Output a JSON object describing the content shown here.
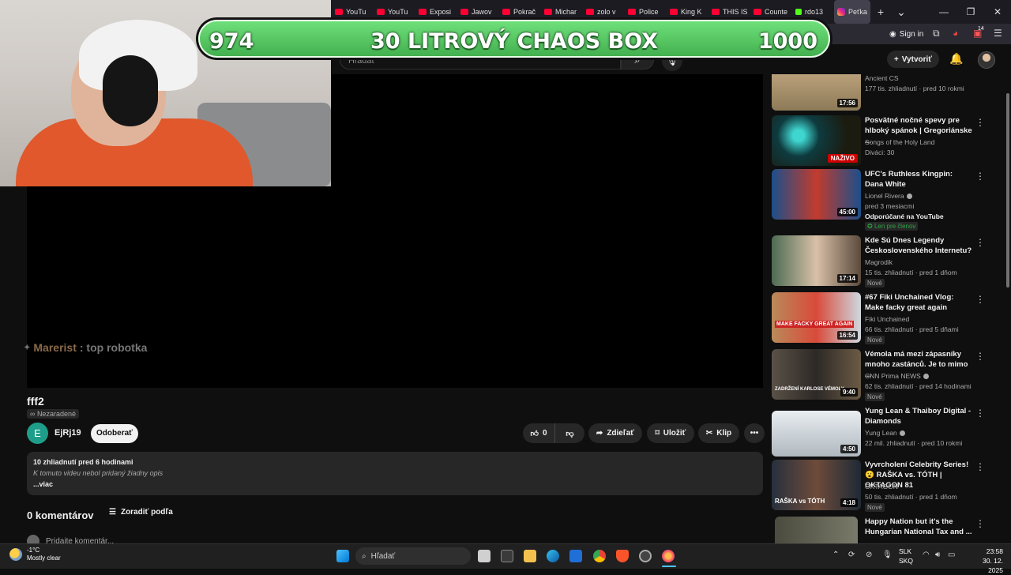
{
  "browser": {
    "tabs": [
      {
        "label": "YouTu",
        "icon": "youtube-icon"
      },
      {
        "label": "YouTu",
        "icon": "youtube-icon"
      },
      {
        "label": "Exposi",
        "icon": "youtube-icon"
      },
      {
        "label": "Jawov",
        "icon": "youtube-icon"
      },
      {
        "label": "Pokrač",
        "icon": "youtube-icon"
      },
      {
        "label": "Michar",
        "icon": "youtube-icon"
      },
      {
        "label": "zolo v",
        "icon": "youtube-icon"
      },
      {
        "label": "Police",
        "icon": "youtube-icon"
      },
      {
        "label": "King K",
        "icon": "youtube-icon"
      },
      {
        "label": "THIS IS",
        "icon": "youtube-icon"
      },
      {
        "label": "Counte",
        "icon": "youtube-icon"
      },
      {
        "label": "rdo13",
        "icon": "kick-icon"
      },
      {
        "label": "Peťka",
        "icon": "instagram-icon"
      }
    ],
    "new_tab_icon": "+",
    "tab_list_icon": "⌄",
    "minimize": "—",
    "maximize": "❐",
    "close": "✕",
    "sign_in": "Sign in",
    "badge_count": "14"
  },
  "overlay": {
    "goal_current": "974",
    "goal_title": "30 LITROVÝ CHAOS BOX",
    "goal_target": "1000",
    "goal_progress": 0.974,
    "chat_user": "Marerist",
    "chat_text": ": top robotka"
  },
  "yt_header": {
    "search_placeholder": "Hľadať",
    "create_label": "Vytvoriť"
  },
  "video": {
    "title": "fff2",
    "visibility": "Nezaradené",
    "channel_initial": "E",
    "channel_name": "EjRj19",
    "subscribe_label": "Odoberať",
    "likes": "0",
    "share_label": "Zdieľať",
    "save_label": "Uložiť",
    "clip_label": "Klip",
    "views_time": "10 zhliadnutí  pred 6 hodinami",
    "description": "K tomuto videu nebol pridaný žiadny opis",
    "more_label": "...viac",
    "comment_count": "0 komentárov",
    "sort_label": "Zoradiť podľa",
    "add_comment_placeholder": "Pridajte komentár..."
  },
  "recommendations": [
    {
      "title": "",
      "channel": "Ancient CS",
      "meta": "177 tis. zhliadnutí · pred 10 rokmi",
      "duration": "17:56",
      "tag": ""
    },
    {
      "title": "Posvätné nočné spevy pre hlboký spánok | Gregoriánske ...",
      "channel": "Songs of the Holy Land",
      "meta": "Diváci: 30",
      "duration": "NAŽIVO",
      "tag": ""
    },
    {
      "title": "UFC's Ruthless Kingpin: Dana White",
      "channel": "Lionel Rivera",
      "meta": "pred 3 mesiacmi",
      "duration": "45:00",
      "tag": "Odporúčané na YouTube",
      "member": "Len pre členov"
    },
    {
      "title": "Kde Sú Dnes Legendy Československého Internetu?",
      "channel": "Magrodik",
      "meta": "15 tis. zhliadnutí · pred 1 dňom",
      "duration": "17:14",
      "tag": "Nové"
    },
    {
      "title": "#67 Fiki Unchained Vlog: Make facky great again",
      "channel": "Fiki Unchained",
      "meta": "66 tis. zhliadnutí · pred 5 dňami",
      "duration": "16:54",
      "tag": "Nové",
      "thumb_text": "MAKE FACKY GREAT AGAIN"
    },
    {
      "title": "Vémola má mezi zápasníky mnoho zastánců. Je to mimo ...",
      "channel": "CNN Prima NEWS",
      "meta": "62 tis. zhliadnutí · pred 14 hodinami",
      "duration": "9:40",
      "tag": "Nové",
      "thumb_text": "ZADRŽENÍ KARLOSE VÉMOLY"
    },
    {
      "title": "Yung Lean & Thaiboy Digital - Diamonds",
      "channel": "Yung Lean",
      "meta": "22 mil. zhliadnutí · pred 10 rokmi",
      "duration": "4:50",
      "tag": ""
    },
    {
      "title": "Vyvrcholení Celebrity Series! 😮 RAŠKA vs. TÓTH | OKTAGON 81",
      "channel": "OKTAGON",
      "meta": "50 tis. zhliadnutí · pred 1 dňom",
      "duration": "4:18",
      "tag": "Nové",
      "thumb_text": "RAŠKA vs TÓTH"
    },
    {
      "title": "Happy Nation but it's the Hungarian National Tax and ...",
      "channel": "",
      "meta": "",
      "duration": "",
      "tag": ""
    }
  ],
  "taskbar": {
    "temp": "-1°C",
    "weather": "Mostly clear",
    "search": "Hľadať",
    "lang1": "SLK",
    "lang2": "SKQ",
    "time": "23:58",
    "date": "30. 12. 2025"
  },
  "colors": {
    "accent_red": "#ff0033",
    "goal_green": "#4cc45a",
    "background": "#0f0f0f"
  }
}
